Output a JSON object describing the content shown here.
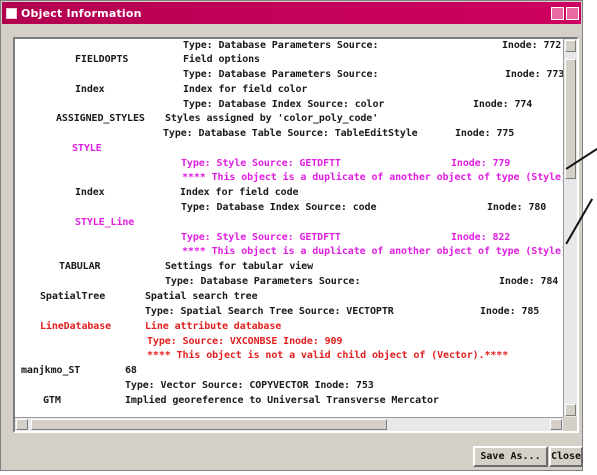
{
  "window": {
    "title": "Object Information"
  },
  "rows": [
    {
      "id": "r1a",
      "name": "",
      "text": "Type: Database Parameters  Source:",
      "inode": "Inode: 772",
      "color": "black"
    },
    {
      "id": "r1b",
      "name": "FIELDOPTS",
      "text": "Field options",
      "inode": "",
      "color": "black"
    },
    {
      "id": "r1c",
      "name": "",
      "text": "Type: Database Parameters  Source:",
      "inode": "Inode: 773",
      "color": "black"
    },
    {
      "id": "r2a",
      "name": "Index",
      "text": "Index for field color",
      "inode": "",
      "color": "black"
    },
    {
      "id": "r2b",
      "name": "",
      "text": "Type: Database Index  Source: color",
      "inode": "Inode: 774",
      "color": "black"
    },
    {
      "id": "r3a",
      "name": "ASSIGNED_STYLES",
      "text": "Styles assigned by 'color_poly_code'",
      "inode": "",
      "color": "black"
    },
    {
      "id": "r3b",
      "name": "",
      "text": "Type: Database Table  Source: TableEditStyle",
      "inode": "Inode: 775",
      "color": "black"
    },
    {
      "id": "r4a",
      "name": "STYLE",
      "text": "",
      "inode": "",
      "color": "magenta"
    },
    {
      "id": "r4b",
      "name": "",
      "text": "Type: Style    Source: GETDFTT",
      "inode": "Inode: 779",
      "color": "magenta"
    },
    {
      "id": "r4c",
      "name": "",
      "text": "**** This object is a duplicate of another object of type (Style)",
      "inode": "",
      "color": "magenta"
    },
    {
      "id": "r5a",
      "name": "Index",
      "text": "Index for field code",
      "inode": "",
      "color": "black"
    },
    {
      "id": "r5b",
      "name": "",
      "text": "Type: Database Index  Source: code",
      "inode": "Inode: 780",
      "color": "black"
    },
    {
      "id": "r6a",
      "name": "STYLE_Line",
      "text": "",
      "inode": "",
      "color": "magenta"
    },
    {
      "id": "r6b",
      "name": "",
      "text": "Type: Style    Source: GETDFTT",
      "inode": "Inode: 822",
      "color": "magenta"
    },
    {
      "id": "r6c",
      "name": "",
      "text": "**** This object is a duplicate of another object of type (Style)",
      "inode": "",
      "color": "magenta"
    },
    {
      "id": "r7a",
      "name": "TABULAR",
      "text": "Settings for tabular view",
      "inode": "",
      "color": "black"
    },
    {
      "id": "r7b",
      "name": "",
      "text": "Type: Database Parameters  Source:",
      "inode": "Inode: 784",
      "color": "black"
    },
    {
      "id": "r8a",
      "name": "SpatialTree",
      "text": "Spatial search tree",
      "inode": "",
      "color": "black"
    },
    {
      "id": "r8b",
      "name": "",
      "text": "Type: Spatial Search Tree  Source: VECTOPTR",
      "inode": "Inode: 785",
      "color": "black"
    },
    {
      "id": "r9a",
      "name": "LineDatabase",
      "text": "Line attribute database",
      "inode": "",
      "color": "red"
    },
    {
      "id": "r9b",
      "name": "",
      "text": "Type:          Source: VXCONBSE        Inode: 909",
      "inode": "",
      "color": "red"
    },
    {
      "id": "r9c",
      "name": "",
      "text": "**** This object is not a valid child object of (Vector).****",
      "inode": "",
      "color": "red"
    },
    {
      "id": "r10a",
      "name": "manjkmo_ST",
      "text": "68",
      "inode": "",
      "color": "black"
    },
    {
      "id": "r10b",
      "name": "",
      "text": "Type: Vector    Source: COPYVECTOR        Inode: 753",
      "inode": "",
      "color": "black"
    },
    {
      "id": "r11a",
      "name": "GTM",
      "text": "Implied georeference to Universal Transverse Mercator",
      "inode": "",
      "color": "black"
    }
  ],
  "buttons": {
    "save_as": "Save As...",
    "close": "Close"
  },
  "colors": {
    "titlebar": "#c30058",
    "normal": "#1a1a1a",
    "duplicate": "#e020e0",
    "invalid": "#e02020"
  }
}
